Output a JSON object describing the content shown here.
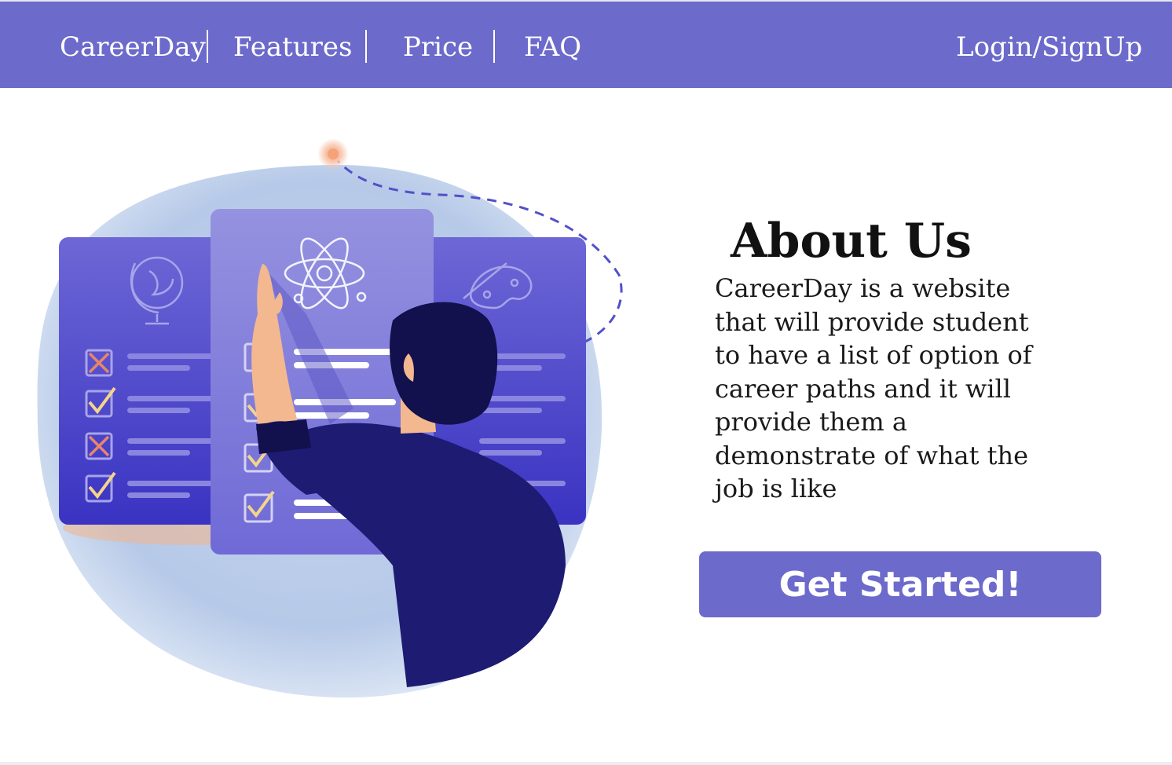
{
  "nav": {
    "brand": "CareerDay",
    "items": [
      {
        "label": "Features"
      },
      {
        "label": "Price"
      },
      {
        "label": "FAQ"
      }
    ],
    "login": "Login/SignUp"
  },
  "about": {
    "title": "About Us",
    "body": "CareerDay is a website that will provide student to have a list of option of career paths and it will provide them a demonstrate of what the job is like"
  },
  "cta": {
    "label": "Get Started!"
  },
  "colors": {
    "brand": "#6c6acb",
    "illustration_dark": "#1d1b72",
    "illustration_card": "#5b57d0"
  }
}
